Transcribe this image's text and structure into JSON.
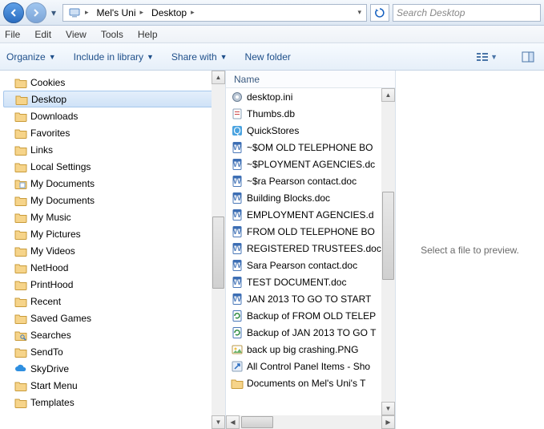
{
  "breadcrumb": {
    "seg1": "Mel's Uni",
    "seg2": "Desktop"
  },
  "search": {
    "placeholder": "Search Desktop"
  },
  "menu": {
    "file": "File",
    "edit": "Edit",
    "view": "View",
    "tools": "Tools",
    "help": "Help"
  },
  "cmd": {
    "organize": "Organize",
    "include": "Include in library",
    "share": "Share with",
    "newfolder": "New folder"
  },
  "tree": {
    "items": [
      {
        "label": "Cookies",
        "icon": "folder"
      },
      {
        "label": "Desktop",
        "icon": "folder-open",
        "selected": true
      },
      {
        "label": "Downloads",
        "icon": "folder"
      },
      {
        "label": "Favorites",
        "icon": "folder"
      },
      {
        "label": "Links",
        "icon": "folder"
      },
      {
        "label": "Local Settings",
        "icon": "folder"
      },
      {
        "label": "My Documents",
        "icon": "folder-docs"
      },
      {
        "label": "My Documents",
        "icon": "folder"
      },
      {
        "label": "My Music",
        "icon": "folder"
      },
      {
        "label": "My Pictures",
        "icon": "folder"
      },
      {
        "label": "My Videos",
        "icon": "folder"
      },
      {
        "label": "NetHood",
        "icon": "folder"
      },
      {
        "label": "PrintHood",
        "icon": "folder"
      },
      {
        "label": "Recent",
        "icon": "folder"
      },
      {
        "label": "Saved Games",
        "icon": "folder"
      },
      {
        "label": "Searches",
        "icon": "folder-search"
      },
      {
        "label": "SendTo",
        "icon": "folder"
      },
      {
        "label": "SkyDrive",
        "icon": "skydrive"
      },
      {
        "label": "Start Menu",
        "icon": "folder"
      },
      {
        "label": "Templates",
        "icon": "folder"
      }
    ]
  },
  "list": {
    "column": "Name",
    "items": [
      {
        "label": "desktop.ini",
        "icon": "ini"
      },
      {
        "label": "Thumbs.db",
        "icon": "db"
      },
      {
        "label": "QuickStores",
        "icon": "app"
      },
      {
        "label": "~$OM OLD TELEPHONE BO",
        "icon": "docx"
      },
      {
        "label": "~$PLOYMENT AGENCIES.dc",
        "icon": "docx"
      },
      {
        "label": "~$ra Pearson contact.doc",
        "icon": "docx"
      },
      {
        "label": "Building Blocks.doc",
        "icon": "doc"
      },
      {
        "label": "EMPLOYMENT AGENCIES.d",
        "icon": "doc"
      },
      {
        "label": "FROM OLD TELEPHONE BO",
        "icon": "doc"
      },
      {
        "label": "REGISTERED TRUSTEES.doc",
        "icon": "doc"
      },
      {
        "label": "Sara Pearson contact.doc",
        "icon": "doc"
      },
      {
        "label": "TEST DOCUMENT.doc",
        "icon": "doc"
      },
      {
        "label": "JAN 2013 TO GO TO START",
        "icon": "docx"
      },
      {
        "label": "Backup of FROM OLD TELEP",
        "icon": "backup"
      },
      {
        "label": "Backup of JAN 2013 TO GO T",
        "icon": "backup"
      },
      {
        "label": "back up big crashing.PNG",
        "icon": "png"
      },
      {
        "label": "All Control Panel Items - Sho",
        "icon": "shortcut"
      },
      {
        "label": "Documents on Mel's Uni's T",
        "icon": "folder"
      }
    ]
  },
  "preview": {
    "empty": "Select a file to preview."
  }
}
